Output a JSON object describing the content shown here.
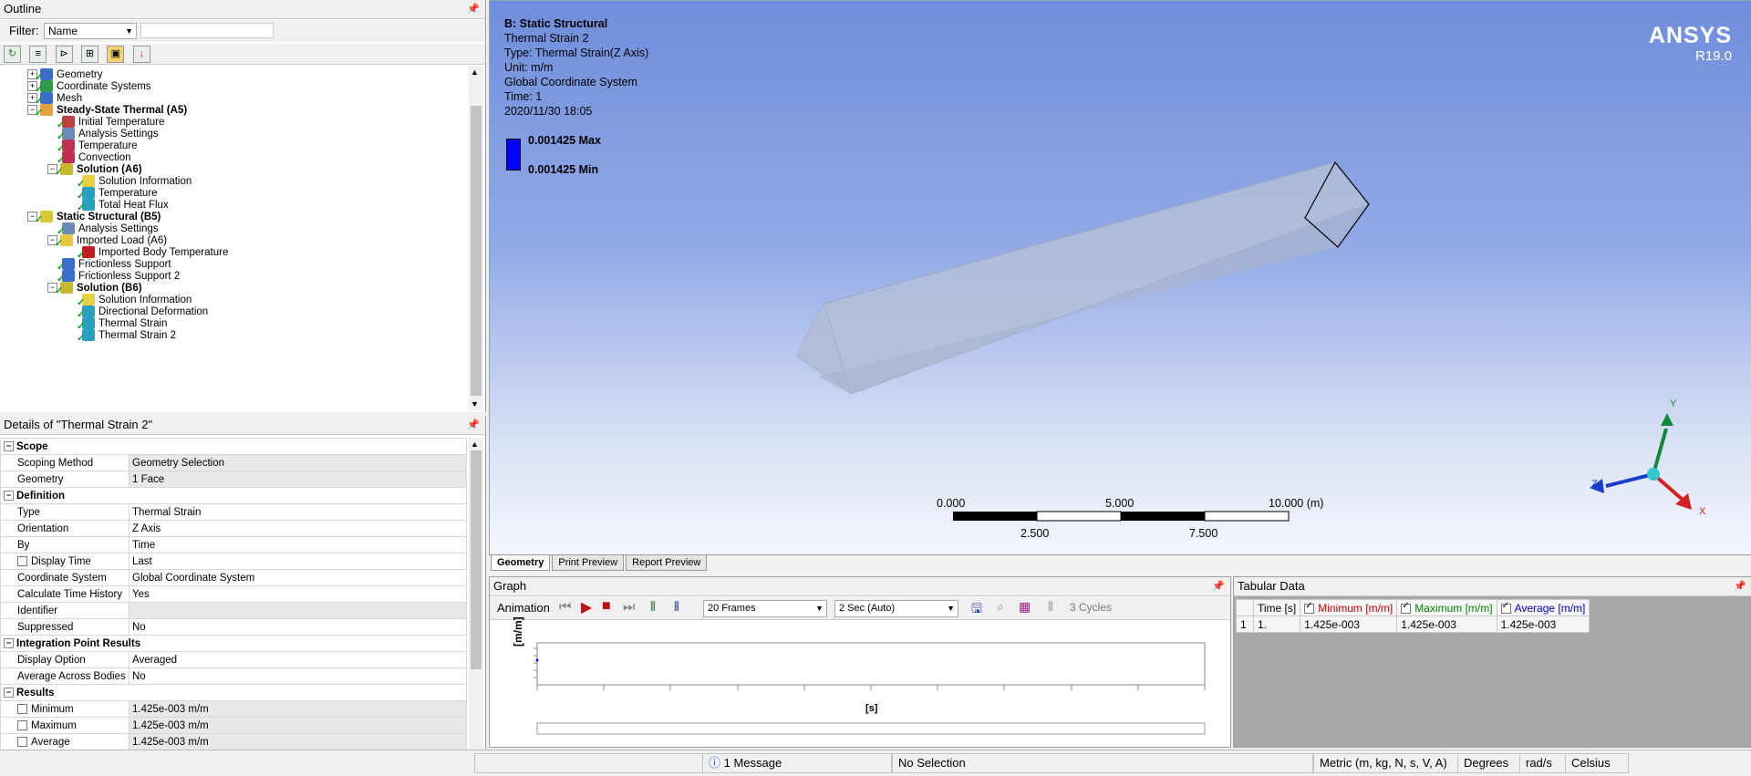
{
  "outline": {
    "title": "Outline",
    "filter_label": "Filter:",
    "filter_value": "Name",
    "search_value": "",
    "tree": [
      {
        "label": "Geometry",
        "depth": 0,
        "bold": false,
        "expander": "+",
        "icon": "geometry-icon"
      },
      {
        "label": "Coordinate Systems",
        "depth": 0,
        "bold": false,
        "expander": "+",
        "icon": "coordinate-systems-icon"
      },
      {
        "label": "Mesh",
        "depth": 0,
        "bold": false,
        "expander": "+",
        "icon": "mesh-icon"
      },
      {
        "label": "Steady-State Thermal (A5)",
        "depth": 0,
        "bold": true,
        "expander": "-",
        "icon": "thermal-analysis-icon"
      },
      {
        "label": "Initial Temperature",
        "depth": 1,
        "bold": false,
        "expander": "",
        "icon": "initial-temperature-icon"
      },
      {
        "label": "Analysis Settings",
        "depth": 1,
        "bold": false,
        "expander": "",
        "icon": "analysis-settings-icon"
      },
      {
        "label": "Temperature",
        "depth": 1,
        "bold": false,
        "expander": "",
        "icon": "temperature-load-icon"
      },
      {
        "label": "Convection",
        "depth": 1,
        "bold": false,
        "expander": "",
        "icon": "convection-icon"
      },
      {
        "label": "Solution (A6)",
        "depth": 1,
        "bold": true,
        "expander": "-",
        "icon": "solution-icon"
      },
      {
        "label": "Solution Information",
        "depth": 2,
        "bold": false,
        "expander": "",
        "icon": "solution-information-icon"
      },
      {
        "label": "Temperature",
        "depth": 2,
        "bold": false,
        "expander": "",
        "icon": "result-icon"
      },
      {
        "label": "Total Heat Flux",
        "depth": 2,
        "bold": false,
        "expander": "",
        "icon": "result-icon"
      },
      {
        "label": "Static Structural (B5)",
        "depth": 0,
        "bold": true,
        "expander": "-",
        "icon": "structural-analysis-icon"
      },
      {
        "label": "Analysis Settings",
        "depth": 1,
        "bold": false,
        "expander": "",
        "icon": "analysis-settings-icon"
      },
      {
        "label": "Imported Load (A6)",
        "depth": 1,
        "bold": false,
        "expander": "-",
        "icon": "imported-load-icon"
      },
      {
        "label": "Imported Body Temperature",
        "depth": 2,
        "bold": false,
        "expander": "",
        "icon": "imported-body-temperature-icon"
      },
      {
        "label": "Frictionless Support",
        "depth": 1,
        "bold": false,
        "expander": "",
        "icon": "support-icon"
      },
      {
        "label": "Frictionless Support 2",
        "depth": 1,
        "bold": false,
        "expander": "",
        "icon": "support-icon"
      },
      {
        "label": "Solution (B6)",
        "depth": 1,
        "bold": true,
        "expander": "-",
        "icon": "solution-icon"
      },
      {
        "label": "Solution Information",
        "depth": 2,
        "bold": false,
        "expander": "",
        "icon": "solution-information-icon"
      },
      {
        "label": "Directional Deformation",
        "depth": 2,
        "bold": false,
        "expander": "",
        "icon": "result-icon"
      },
      {
        "label": "Thermal Strain",
        "depth": 2,
        "bold": false,
        "expander": "",
        "icon": "result-icon"
      },
      {
        "label": "Thermal Strain 2",
        "depth": 2,
        "bold": false,
        "expander": "",
        "icon": "result-icon"
      }
    ]
  },
  "details": {
    "title": "Details of \"Thermal Strain 2\"",
    "rows": [
      {
        "section": "Scope"
      },
      {
        "label": "Scoping Method",
        "value": "Geometry Selection",
        "gray": true
      },
      {
        "label": "Geometry",
        "value": "1 Face",
        "gray": true
      },
      {
        "section": "Definition"
      },
      {
        "label": "Type",
        "value": "Thermal Strain"
      },
      {
        "label": "Orientation",
        "value": "Z Axis"
      },
      {
        "label": "By",
        "value": "Time"
      },
      {
        "label": "Display Time",
        "value": "Last",
        "checkbox": true
      },
      {
        "label": "Coordinate System",
        "value": "Global Coordinate System"
      },
      {
        "label": "Calculate Time History",
        "value": "Yes"
      },
      {
        "label": "Identifier",
        "value": "",
        "gray": true
      },
      {
        "label": "Suppressed",
        "value": "No"
      },
      {
        "section": "Integration Point Results"
      },
      {
        "label": "Display Option",
        "value": "Averaged"
      },
      {
        "label": "Average Across Bodies",
        "value": "No"
      },
      {
        "section": "Results"
      },
      {
        "label": "Minimum",
        "value": "1.425e-003 m/m",
        "checkbox": true,
        "gray": true
      },
      {
        "label": "Maximum",
        "value": "1.425e-003 m/m",
        "checkbox": true,
        "gray": true
      },
      {
        "label": "Average",
        "value": "1.425e-003 m/m",
        "checkbox": true,
        "gray": true
      }
    ]
  },
  "viewport": {
    "header_title": "B: Static Structural",
    "header_lines": [
      "Thermal Strain 2",
      "Type: Thermal Strain(Z Axis)",
      "Unit: m/m",
      "Global Coordinate System",
      "Time: 1",
      "2020/11/30 18:05"
    ],
    "legend_max": "0.001425 Max",
    "legend_min": "0.001425 Min",
    "legend_color": "#0000ff",
    "brand": "ANSYS",
    "version": "R19.0",
    "scale_top": [
      "0.000",
      "5.000",
      "10.000 (m)"
    ],
    "scale_bottom": [
      "2.500",
      "7.500"
    ],
    "axis_labels": {
      "x": "X",
      "y": "Y",
      "z": "Z"
    },
    "axis_colors": {
      "x": "#d42020",
      "y": "#14883a",
      "z": "#1a3cc8"
    }
  },
  "view_tabs": [
    "Geometry",
    "Print Preview",
    "Report Preview"
  ],
  "graph": {
    "title": "Graph",
    "animation_label": "Animation",
    "frames": "20 Frames",
    "duration": "2 Sec (Auto)",
    "cycles": "3 Cycles",
    "ylabel": "[m/m]",
    "xlabel": "[s]"
  },
  "tabular": {
    "title": "Tabular Data",
    "headers": [
      "Time [s]",
      "Minimum [m/m]",
      "Maximum [m/m]",
      "Average [m/m]"
    ],
    "header_colors": [
      "#000000",
      "#cc0000",
      "#008800",
      "#0000cc"
    ],
    "rows": [
      [
        "1",
        "1.",
        "1.425e-003",
        "1.425e-003",
        "1.425e-003"
      ]
    ]
  },
  "status": {
    "messages": "1 Message",
    "selection": "No Selection",
    "units": "Metric (m, kg, N, s, V, A)",
    "angle": "Degrees",
    "rot": "rad/s",
    "temp": "Celsius"
  }
}
